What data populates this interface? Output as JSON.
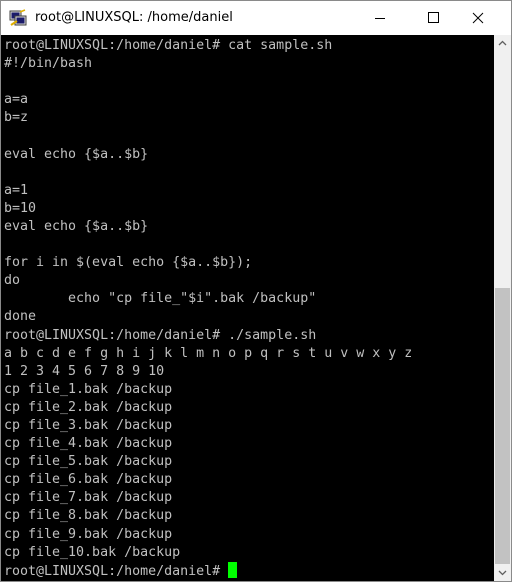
{
  "window": {
    "title": "root@LINUXSQL: /home/daniel",
    "icon": "putty-icon"
  },
  "controls": {
    "minimize_icon": "minimize-icon",
    "maximize_icon": "maximize-icon",
    "close_icon": "close-icon"
  },
  "terminal": {
    "lines": [
      "root@LINUXSQL:/home/daniel# cat sample.sh",
      "#!/bin/bash",
      "",
      "a=a",
      "b=z",
      "",
      "eval echo {$a..$b}",
      "",
      "a=1",
      "b=10",
      "eval echo {$a..$b}",
      "",
      "for i in $(eval echo {$a..$b});",
      "do",
      "        echo \"cp file_\"$i\".bak /backup\"",
      "done",
      "root@LINUXSQL:/home/daniel# ./sample.sh",
      "a b c d e f g h i j k l m n o p q r s t u v w x y z",
      "1 2 3 4 5 6 7 8 9 10",
      "cp file_1.bak /backup",
      "cp file_2.bak /backup",
      "cp file_3.bak /backup",
      "cp file_4.bak /backup",
      "cp file_5.bak /backup",
      "cp file_6.bak /backup",
      "cp file_7.bak /backup",
      "cp file_8.bak /backup",
      "cp file_9.bak /backup",
      "cp file_10.bak /backup"
    ],
    "prompt": "root@LINUXSQL:/home/daniel#",
    "cursor_color": "#00ff00",
    "text_color": "#c0c0c0",
    "background": "#000000"
  },
  "scrollbar": {
    "position_fraction": 0.46,
    "visible_fraction": 0.54
  }
}
